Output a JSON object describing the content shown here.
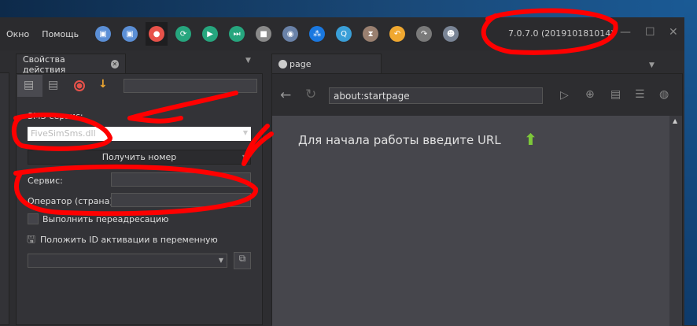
{
  "menu": {
    "items": [
      "Окно",
      "Помощь"
    ]
  },
  "toolbar": {
    "buttons": [
      {
        "icon": "save-icon",
        "color": "#5b8fd6"
      },
      {
        "icon": "save-as-icon",
        "color": "#5b8fd6"
      },
      {
        "icon": "record-icon",
        "color": "#e8524a"
      },
      {
        "icon": "repeat-icon",
        "color": "#26a67e"
      },
      {
        "icon": "play-icon",
        "color": "#26a67e"
      },
      {
        "icon": "step-icon",
        "color": "#26a67e"
      },
      {
        "icon": "stop-icon",
        "color": "#8a8a8a"
      },
      {
        "icon": "eye-icon",
        "color": "#6a82a8"
      },
      {
        "icon": "network-icon",
        "color": "#1a78e0"
      },
      {
        "icon": "search-icon",
        "color": "#3a9fd8"
      },
      {
        "icon": "hourglass-icon",
        "color": "#9a8070"
      },
      {
        "icon": "undo-icon",
        "color": "#f0a830"
      },
      {
        "icon": "redo-icon",
        "color": "#7a7a7a"
      },
      {
        "icon": "user-icon",
        "color": "#7a8596"
      }
    ]
  },
  "version": "7.0.7.0 (201910181014)",
  "left_panel": {
    "tab_label": "Свойства действия",
    "sms_label": "SMS-сервис:",
    "sms_value": "FiveSimSms.dll",
    "action_select": "Получить номер",
    "service_label": "Сервис:",
    "operator_label": "Оператор (страна):",
    "redirect_label": "Выполнить переадресацию",
    "put_id_label": "Положить ID активации в переменную"
  },
  "right_panel": {
    "tab_label": "page",
    "url": "about:startpage",
    "start_message": "Для начала работы введите URL"
  }
}
